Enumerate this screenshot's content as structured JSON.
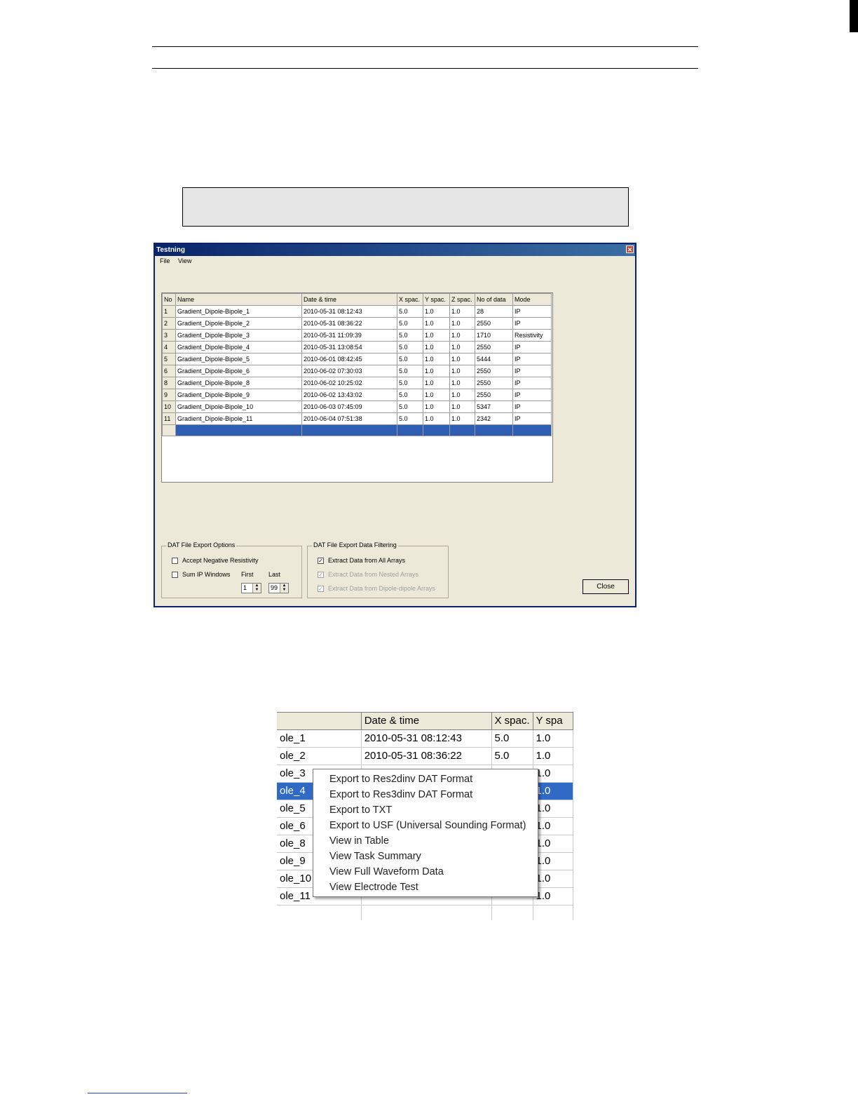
{
  "window": {
    "title": "Testning",
    "close_glyph": "✕",
    "menu": [
      "File",
      "View"
    ]
  },
  "grid": {
    "columns": [
      "No",
      "Name",
      "Date & time",
      "X spac.",
      "Y spac.",
      "Z spac.",
      "No of data",
      "Mode"
    ],
    "rows": [
      [
        "1",
        "Gradient_Dipole-Bipole_1",
        "2010-05-31 08:12:43",
        "5.0",
        "1.0",
        "1.0",
        "28",
        "IP"
      ],
      [
        "2",
        "Gradient_Dipole-Bipole_2",
        "2010-05-31 08:36:22",
        "5.0",
        "1.0",
        "1.0",
        "2550",
        "IP"
      ],
      [
        "3",
        "Gradient_Dipole-Bipole_3",
        "2010-05-31 11:09:39",
        "5.0",
        "1.0",
        "1.0",
        "1710",
        "Resistivity"
      ],
      [
        "4",
        "Gradient_Dipole-Bipole_4",
        "2010-05-31 13:08:54",
        "5.0",
        "1.0",
        "1.0",
        "2550",
        "IP"
      ],
      [
        "5",
        "Gradient_Dipole-Bipole_5",
        "2010-06-01 08:42:45",
        "5.0",
        "1.0",
        "1.0",
        "5444",
        "IP"
      ],
      [
        "6",
        "Gradient_Dipole-Bipole_6",
        "2010-06-02 07:30:03",
        "5.0",
        "1.0",
        "1.0",
        "2550",
        "IP"
      ],
      [
        "8",
        "Gradient_Dipole-Bipole_8",
        "2010-06-02 10:25:02",
        "5.0",
        "1.0",
        "1.0",
        "2550",
        "IP"
      ],
      [
        "9",
        "Gradient_Dipole-Bipole_9",
        "2010-06-02 13:43:02",
        "5.0",
        "1.0",
        "1.0",
        "2550",
        "IP"
      ],
      [
        "10",
        "Gradient_Dipole-Bipole_10",
        "2010-06-03 07:45:09",
        "5.0",
        "1.0",
        "1.0",
        "5347",
        "IP"
      ],
      [
        "11",
        "Gradient_Dipole-Bipole_11",
        "2010-06-04 07:51:38",
        "5.0",
        "1.0",
        "1.0",
        "2342",
        "IP"
      ]
    ]
  },
  "export_options": {
    "title": "DAT File Export Options",
    "accept_negative": "Accept Negative Resistivity",
    "sum_ip": "Sum IP Windows",
    "first_label": "First",
    "last_label": "Last",
    "first_value": "1",
    "last_value": "99"
  },
  "filtering": {
    "title": "DAT File Export Data Filtering",
    "all_arrays": "Extract Data from All Arrays",
    "nested": "Extract Data from Nested Arrays",
    "dipole": "Extract Data from Dipole-dipole Arrays",
    "check_glyph": "✓"
  },
  "close_button": "Close",
  "zoom": {
    "columns": [
      "",
      "Date & time",
      "X spac.",
      "Y spa"
    ],
    "rows": [
      [
        "ole_1",
        "2010-05-31 08:12:43",
        "5.0",
        "1.0"
      ],
      [
        "ole_2",
        "2010-05-31 08:36:22",
        "5.0",
        "1.0"
      ],
      [
        "ole_3",
        "",
        "",
        "1.0"
      ],
      [
        "ole_4",
        "",
        "",
        "1.0"
      ],
      [
        "ole_5",
        "",
        "",
        "1.0"
      ],
      [
        "ole_6",
        "",
        "",
        "1.0"
      ],
      [
        "ole_8",
        "",
        "",
        "1.0"
      ],
      [
        "ole_9",
        "",
        "",
        "1.0"
      ],
      [
        "ole_10",
        "",
        "",
        "1.0"
      ],
      [
        "ole_11",
        "",
        "",
        "1.0"
      ]
    ],
    "selected_row": 3
  },
  "context_menu": [
    "Export to Res2dinv DAT Format",
    "Export to Res3dinv DAT Format",
    "Export to TXT",
    "Export to USF (Universal Sounding Format)",
    "View in Table",
    "View Task Summary",
    "View Full Waveform Data",
    "View Electrode Test"
  ],
  "colors": {
    "selection": "#316ac5",
    "titlebar": "#0a246a",
    "window_bg": "#ece9d8"
  }
}
